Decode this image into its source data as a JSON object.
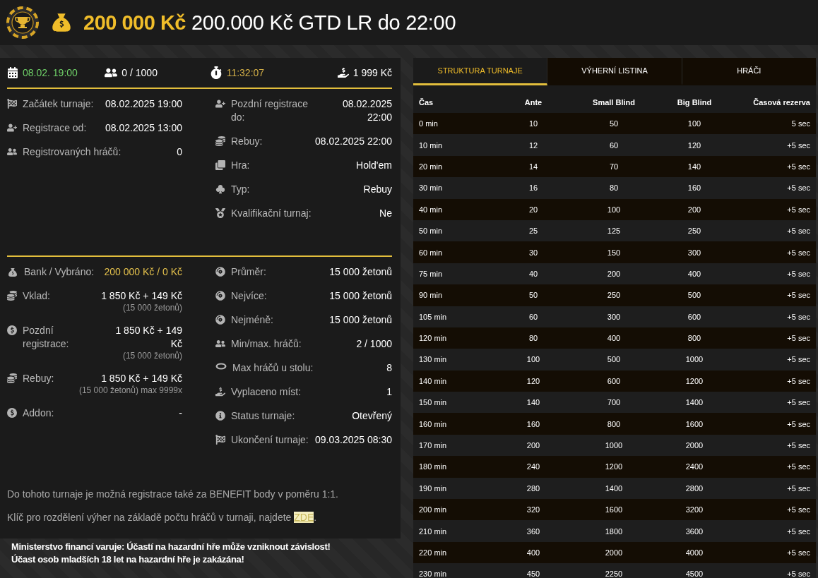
{
  "header": {
    "prize": "200 000 Kč",
    "title": "200.000 Kč GTD LR do 22:00"
  },
  "stats": [
    {
      "kind": "date",
      "text": "08.02. 19:00"
    },
    {
      "kind": "players",
      "text": "0 / 1000"
    },
    {
      "kind": "timer",
      "text": "11:32:07"
    },
    {
      "kind": "buyin",
      "text": "1 999 Kč"
    }
  ],
  "info_left": [
    {
      "kind": "flag",
      "label": "Začátek turnaje:",
      "value": "08.02.2025 19:00"
    },
    {
      "kind": "user-plus",
      "label": "Registrace od:",
      "value": "08.02.2025 13:00"
    },
    {
      "kind": "users",
      "label": "Registrovaných hráčů:",
      "value": "0"
    }
  ],
  "info_right": [
    {
      "kind": "user-plus",
      "label": "Pozdní registrace do:",
      "value": "08.02.2025 22:00"
    },
    {
      "kind": "coins",
      "label": "Rebuy:",
      "value": "08.02.2025 22:00"
    },
    {
      "kind": "cards",
      "label": "Hra:",
      "value": "Hold'em"
    },
    {
      "kind": "suits",
      "label": "Typ:",
      "value": "Rebuy"
    },
    {
      "kind": "medal",
      "label": "Kvalifikační turnaj:",
      "value": "Ne"
    }
  ],
  "finance_left": [
    {
      "kind": "bag",
      "label": "Bank / Vybráno:",
      "value": "200 000 Kč / 0 Kč",
      "highlighted": true
    },
    {
      "kind": "coins",
      "label": "Vklad:",
      "value": "1 850 Kč + 149 Kč",
      "note": "(15 000 žetonů)",
      "highlighted": false
    },
    {
      "kind": "dollar",
      "label": "Pozdní registrace:",
      "value": "1 850 Kč + 149 Kč",
      "note": "(15 000 žetonů)",
      "highlighted": false
    },
    {
      "kind": "coins",
      "label": "Rebuy:",
      "value": "1 850 Kč + 149 Kč",
      "note": "(15 000 žetonů) max 9999x",
      "highlighted": false
    },
    {
      "kind": "dollar",
      "label": "Addon:",
      "value": "-",
      "highlighted": false
    }
  ],
  "finance_right": [
    {
      "kind": "chip",
      "label": "Průměr:",
      "value": "15 000 žetonů"
    },
    {
      "kind": "chip",
      "label": "Nejvíce:",
      "value": "15 000 žetonů"
    },
    {
      "kind": "chip",
      "label": "Nejméně:",
      "value": "15 000 žetonů"
    },
    {
      "kind": "users",
      "label": "Min/max. hráčů:",
      "value": "2 / 1000"
    },
    {
      "kind": "table",
      "label": "Max hráčů u stolu:",
      "value": "8"
    },
    {
      "kind": "payout",
      "label": "Vyplaceno míst:",
      "value": "1"
    },
    {
      "kind": "info",
      "label": "Status turnaje:",
      "value": "Otevřený"
    },
    {
      "kind": "flag",
      "label": "Ukončení turnaje:",
      "value": "09.03.2025 08:30"
    }
  ],
  "notes": [
    {
      "text": "Do tohoto turnaje je možná registrace také za BENEFIT body v poměru 1:1."
    },
    {
      "text": "Klíč pro rozdělení výher na základě počtu hráčů v turnaji, najdete ",
      "link": "ZDE",
      "after": "."
    }
  ],
  "warning": [
    "Ministerstvo financí varuje: Účastí na hazardní hře může vzniknout závislost!",
    "Účast osob mladších 18 let na hazardní hře je zakázána!"
  ],
  "tabs": [
    {
      "label": "STRUKTURA TURNAJE",
      "selected": true
    },
    {
      "label": "VÝHERNÍ LISTINA",
      "selected": false
    },
    {
      "label": "HRÁČI",
      "selected": false
    }
  ],
  "table": {
    "columns": [
      "Čas",
      "Ante",
      "Small Blind",
      "Big Blind",
      "Časová rezerva"
    ],
    "rows": [
      [
        "0 min",
        "10",
        "50",
        "100",
        "5 sec"
      ],
      [
        "10 min",
        "12",
        "60",
        "120",
        "+5 sec"
      ],
      [
        "20 min",
        "14",
        "70",
        "140",
        "+5 sec"
      ],
      [
        "30 min",
        "16",
        "80",
        "160",
        "+5 sec"
      ],
      [
        "40 min",
        "20",
        "100",
        "200",
        "+5 sec"
      ],
      [
        "50 min",
        "25",
        "125",
        "250",
        "+5 sec"
      ],
      [
        "60 min",
        "30",
        "150",
        "300",
        "+5 sec"
      ],
      [
        "75 min",
        "40",
        "200",
        "400",
        "+5 sec"
      ],
      [
        "90 min",
        "50",
        "250",
        "500",
        "+5 sec"
      ],
      [
        "105 min",
        "60",
        "300",
        "600",
        "+5 sec"
      ],
      [
        "120 min",
        "80",
        "400",
        "800",
        "+5 sec"
      ],
      [
        "130 min",
        "100",
        "500",
        "1000",
        "+5 sec"
      ],
      [
        "140 min",
        "120",
        "600",
        "1200",
        "+5 sec"
      ],
      [
        "150 min",
        "140",
        "700",
        "1400",
        "+5 sec"
      ],
      [
        "160 min",
        "160",
        "800",
        "1600",
        "+5 sec"
      ],
      [
        "170 min",
        "200",
        "1000",
        "2000",
        "+5 sec"
      ],
      [
        "180 min",
        "240",
        "1200",
        "2400",
        "+5 sec"
      ],
      [
        "190 min",
        "280",
        "1400",
        "2800",
        "+5 sec"
      ],
      [
        "200 min",
        "320",
        "1600",
        "3200",
        "+5 sec"
      ],
      [
        "210 min",
        "360",
        "1800",
        "3600",
        "+5 sec"
      ],
      [
        "220 min",
        "400",
        "2000",
        "4000",
        "+5 sec"
      ],
      [
        "230 min",
        "450",
        "2250",
        "4500",
        "+5 sec"
      ]
    ]
  }
}
